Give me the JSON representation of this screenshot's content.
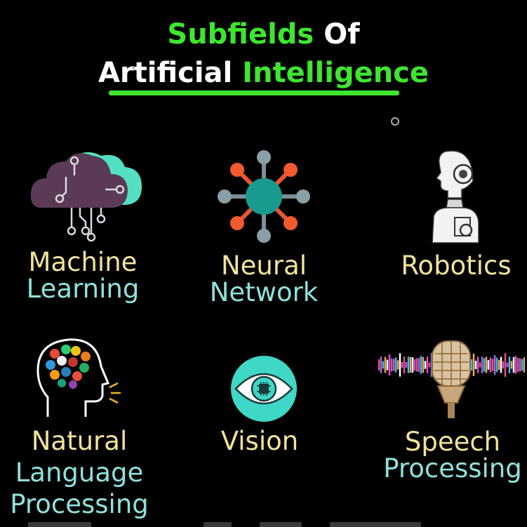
{
  "title": {
    "line1_part1": "Subfields",
    "line1_part2": "Of",
    "line2_part1": "Artificial",
    "line2_part2": "Intelligence"
  },
  "items": [
    {
      "line1": "Machine",
      "line2": "Learning",
      "icon": "cloud-circuit-icon"
    },
    {
      "line1": "Neural",
      "line2": "Network",
      "icon": "neural-network-icon"
    },
    {
      "line1": "Robotics",
      "icon": "robot-head-icon"
    },
    {
      "line1": "Natural",
      "line2": "Language",
      "line3": "Processing",
      "icon": "head-languages-icon"
    },
    {
      "line1": "Vision",
      "icon": "eye-chip-icon"
    },
    {
      "line1": "Speech",
      "line2": "Processing",
      "icon": "microphone-soundwave-icon"
    }
  ],
  "colors": {
    "background": "#000000",
    "accent_green": "#3ee62f",
    "label_yellow": "#f2e39b",
    "label_cyan": "#8fe1dc"
  }
}
